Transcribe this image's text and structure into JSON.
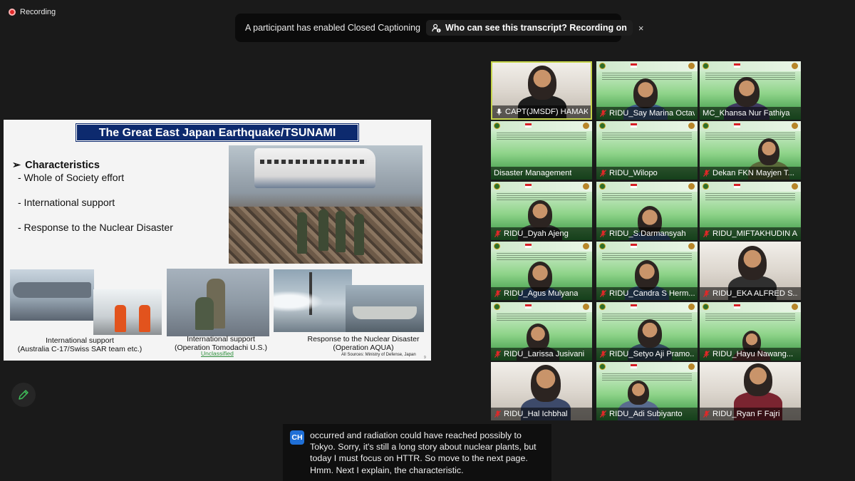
{
  "recording": {
    "label": "Recording"
  },
  "banner": {
    "message": "A participant has enabled Closed Captioning",
    "link_label": "Who can see this transcript? Recording on",
    "close_label": "×"
  },
  "slide": {
    "title": "The Great East Japan Earthquake/TSUNAMI",
    "heading": "Characteristics",
    "bullet_glyph": "➢",
    "items": [
      "- Whole of Society effort",
      "- International support",
      "- Response to the Nuclear Disaster"
    ],
    "captions": [
      {
        "line1": "International support",
        "line2": "(Australia C-17/Swiss SAR team etc.)"
      },
      {
        "line1": "International support",
        "line2": "(Operation Tomodachi U.S.)"
      },
      {
        "line1": "Response to the Nuclear Disaster",
        "line2": "(Operation AQUA)"
      }
    ],
    "unclassified": "Unclassified",
    "source": "All Sources: Ministry of Defense, Japan",
    "page_number": "9"
  },
  "participants": [
    {
      "name": "CAPT(JMSDF) HAMAK...",
      "status": "unmuted",
      "active": true
    },
    {
      "name": "RIDU_Say Marina Octavia",
      "status": "muted",
      "active": false
    },
    {
      "name": "MC_Khansa Nur Fathiya",
      "status": "none",
      "active": false
    },
    {
      "name": "Disaster Management",
      "status": "none",
      "active": false
    },
    {
      "name": "RIDU_Wilopo",
      "status": "muted",
      "active": false
    },
    {
      "name": "Dekan FKN Mayjen T...",
      "status": "muted",
      "active": false
    },
    {
      "name": "RIDU_Dyah Ajeng",
      "status": "muted",
      "active": false
    },
    {
      "name": "RIDU_S.Darmansyah",
      "status": "muted",
      "active": false
    },
    {
      "name": "RIDU_MIFTAKHUDIN A...",
      "status": "muted",
      "active": false
    },
    {
      "name": "RIDU_Agus Mulyana",
      "status": "muted",
      "active": false
    },
    {
      "name": "RIDU_Candra S Herm...",
      "status": "muted",
      "active": false
    },
    {
      "name": "RIDU_EKA ALFRED S...",
      "status": "muted",
      "active": false
    },
    {
      "name": "RIDU_Larissa Jusivani",
      "status": "muted",
      "active": false
    },
    {
      "name": "RIDU_Setyo Aji Pramo...",
      "status": "muted",
      "active": false
    },
    {
      "name": "RIDU_Hayu Nawang...",
      "status": "muted",
      "active": false
    },
    {
      "name": "RIDU_Hal Ichbhal",
      "status": "muted",
      "active": false
    },
    {
      "name": "RIDU_Adi Subiyanto",
      "status": "muted",
      "active": false
    },
    {
      "name": "RIDU_Ryan F Fajri",
      "status": "muted",
      "active": false
    }
  ],
  "transcript": {
    "speaker_initials": "CH",
    "text": "occurred and radiation could have reached possibly to Tokyo. Sorry, it's still a long story about nuclear plants, but today I must focus on HTTR. So move to the next page. Hmm. Next I explain, the characteristic."
  },
  "colors": {
    "background": "#1a1a1a",
    "active_speaker_border": "#c5d44a",
    "muted_icon": "#e02828",
    "slide_title_bg": "#0d2a6e",
    "virtual_bg_green": "#8fd48a",
    "transcript_avatar": "#1f6fd6"
  },
  "icons": {
    "recording": "recording-dot-icon",
    "transcript_info": "person-info-icon",
    "close": "close-icon",
    "annotate": "pencil-icon",
    "muted": "mic-muted-icon",
    "unmuted": "mic-icon"
  }
}
